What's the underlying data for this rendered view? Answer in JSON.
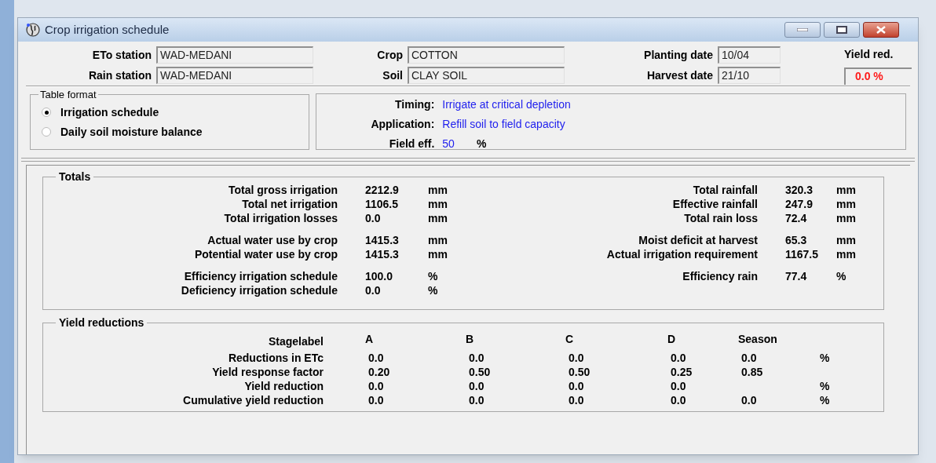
{
  "window": {
    "title": "Crop irrigation schedule"
  },
  "header": {
    "left": [
      {
        "label": "ETo station",
        "value": "WAD-MEDANI"
      },
      {
        "label": "Rain station",
        "value": "WAD-MEDANI"
      }
    ],
    "middle": [
      {
        "label": "Crop",
        "value": "COTTON"
      },
      {
        "label": "Soil",
        "value": "CLAY SOIL"
      }
    ],
    "right": [
      {
        "label": "Planting date",
        "value": "10/04"
      },
      {
        "label": "Harvest date",
        "value": "21/10"
      }
    ],
    "yield_red": {
      "label": "Yield red.",
      "value": "0.0 %"
    }
  },
  "table_format": {
    "title": "Table format",
    "options": [
      {
        "label": "Irrigation schedule",
        "selected": true
      },
      {
        "label": "Daily soil moisture balance",
        "selected": false
      }
    ]
  },
  "strategy": [
    {
      "label": "Timing:",
      "value": "Irrigate at critical depletion"
    },
    {
      "label": "Application:",
      "value": "Refill soil to field capacity"
    },
    {
      "label": "Field eff.",
      "value": "50",
      "unit": "%"
    }
  ],
  "totals": {
    "title": "Totals",
    "groups": [
      [
        {
          "left": {
            "label": "Total gross irrigation",
            "value": "2212.9",
            "unit": "mm"
          },
          "right": {
            "label": "Total rainfall",
            "value": "320.3",
            "unit": "mm"
          }
        },
        {
          "left": {
            "label": "Total net irrigation",
            "value": "1106.5",
            "unit": "mm"
          },
          "right": {
            "label": "Effective rainfall",
            "value": "247.9",
            "unit": "mm"
          }
        },
        {
          "left": {
            "label": "Total irrigation losses",
            "value": "0.0",
            "unit": "mm"
          },
          "right": {
            "label": "Total rain loss",
            "value": "72.4",
            "unit": "mm"
          }
        }
      ],
      [
        {
          "left": {
            "label": "Actual water use by crop",
            "value": "1415.3",
            "unit": "mm"
          },
          "right": {
            "label": "Moist deficit at harvest",
            "value": "65.3",
            "unit": "mm"
          }
        },
        {
          "left": {
            "label": "Potential water use by crop",
            "value": "1415.3",
            "unit": "mm"
          },
          "right": {
            "label": "Actual irrigation requirement",
            "value": "1167.5",
            "unit": "mm"
          }
        }
      ],
      [
        {
          "left": {
            "label": "Efficiency irrigation schedule",
            "value": "100.0",
            "unit": "%"
          },
          "right": {
            "label": "Efficiency rain",
            "value": "77.4",
            "unit": "%"
          }
        },
        {
          "left": {
            "label": "Deficiency irrigation schedule",
            "value": "0.0",
            "unit": "%"
          }
        }
      ]
    ]
  },
  "yield_reductions": {
    "title": "Yield reductions",
    "header_label": "Stagelabel",
    "columns": [
      "A",
      "B",
      "C",
      "D",
      "Season"
    ],
    "rows": [
      {
        "label": "Reductions in ETc",
        "values": [
          "0.0",
          "0.0",
          "0.0",
          "0.0"
        ],
        "season": "0.0",
        "unit": "%"
      },
      {
        "label": "Yield response factor",
        "values": [
          "0.20",
          "0.50",
          "0.50",
          "0.25"
        ],
        "season": "0.85"
      },
      {
        "label": "Yield reduction",
        "values": [
          "0.0",
          "0.0",
          "0.0",
          "0.0"
        ],
        "unit": "%"
      },
      {
        "label": "Cumulative yield reduction",
        "values": [
          "0.0",
          "0.0",
          "0.0",
          "0.0"
        ],
        "season": "0.0",
        "unit": "%"
      }
    ]
  }
}
